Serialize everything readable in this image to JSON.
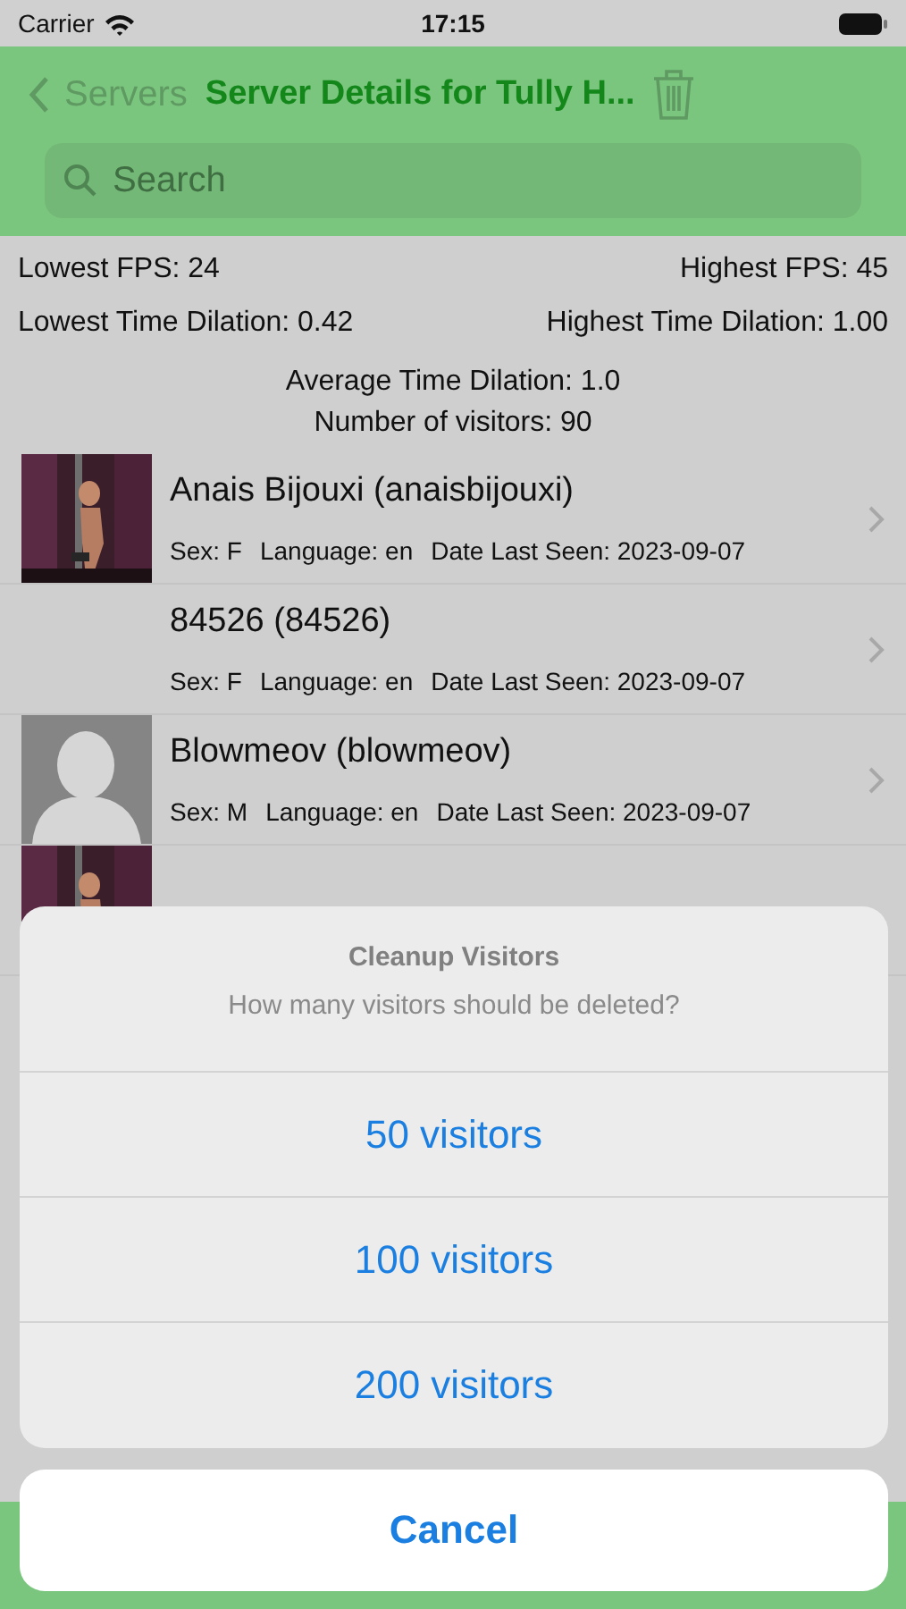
{
  "status_bar": {
    "carrier": "Carrier",
    "time": "17:15"
  },
  "nav": {
    "back_label": "Servers",
    "title": "Server Details for Tully H..."
  },
  "search": {
    "placeholder": "Search"
  },
  "stats": [
    {
      "left": "Lowest FPS: 24",
      "right": "Highest FPS: 45"
    },
    {
      "left": "Lowest Time Dilation: 0.42",
      "right": "Highest Time Dilation: 1.00"
    }
  ],
  "summary": [
    "Average Time Dilation: 1.0",
    "Number of visitors: 90"
  ],
  "visitors": [
    {
      "kind": "picture",
      "name": "Anais Bijouxi (anaisbijouxi)",
      "sex": "Sex: F",
      "language": "Language: en",
      "last_seen": "Date Last Seen: 2023-09-07"
    },
    {
      "kind": "blank",
      "name": "84526 (84526)",
      "sex": "Sex: F",
      "language": "Language: en",
      "last_seen": "Date Last Seen: 2023-09-07"
    },
    {
      "kind": "placeholder",
      "name": "Blowmeov (blowmeov)",
      "sex": "Sex: M",
      "language": "Language: en",
      "last_seen": "Date Last Seen: 2023-09-07"
    },
    {
      "kind": "picture"
    }
  ],
  "action_sheet": {
    "title": "Cleanup Visitors",
    "message": "How many visitors should be deleted?",
    "options": [
      "50 visitors",
      "100 visitors",
      "200 visitors"
    ],
    "cancel": "Cancel"
  }
}
